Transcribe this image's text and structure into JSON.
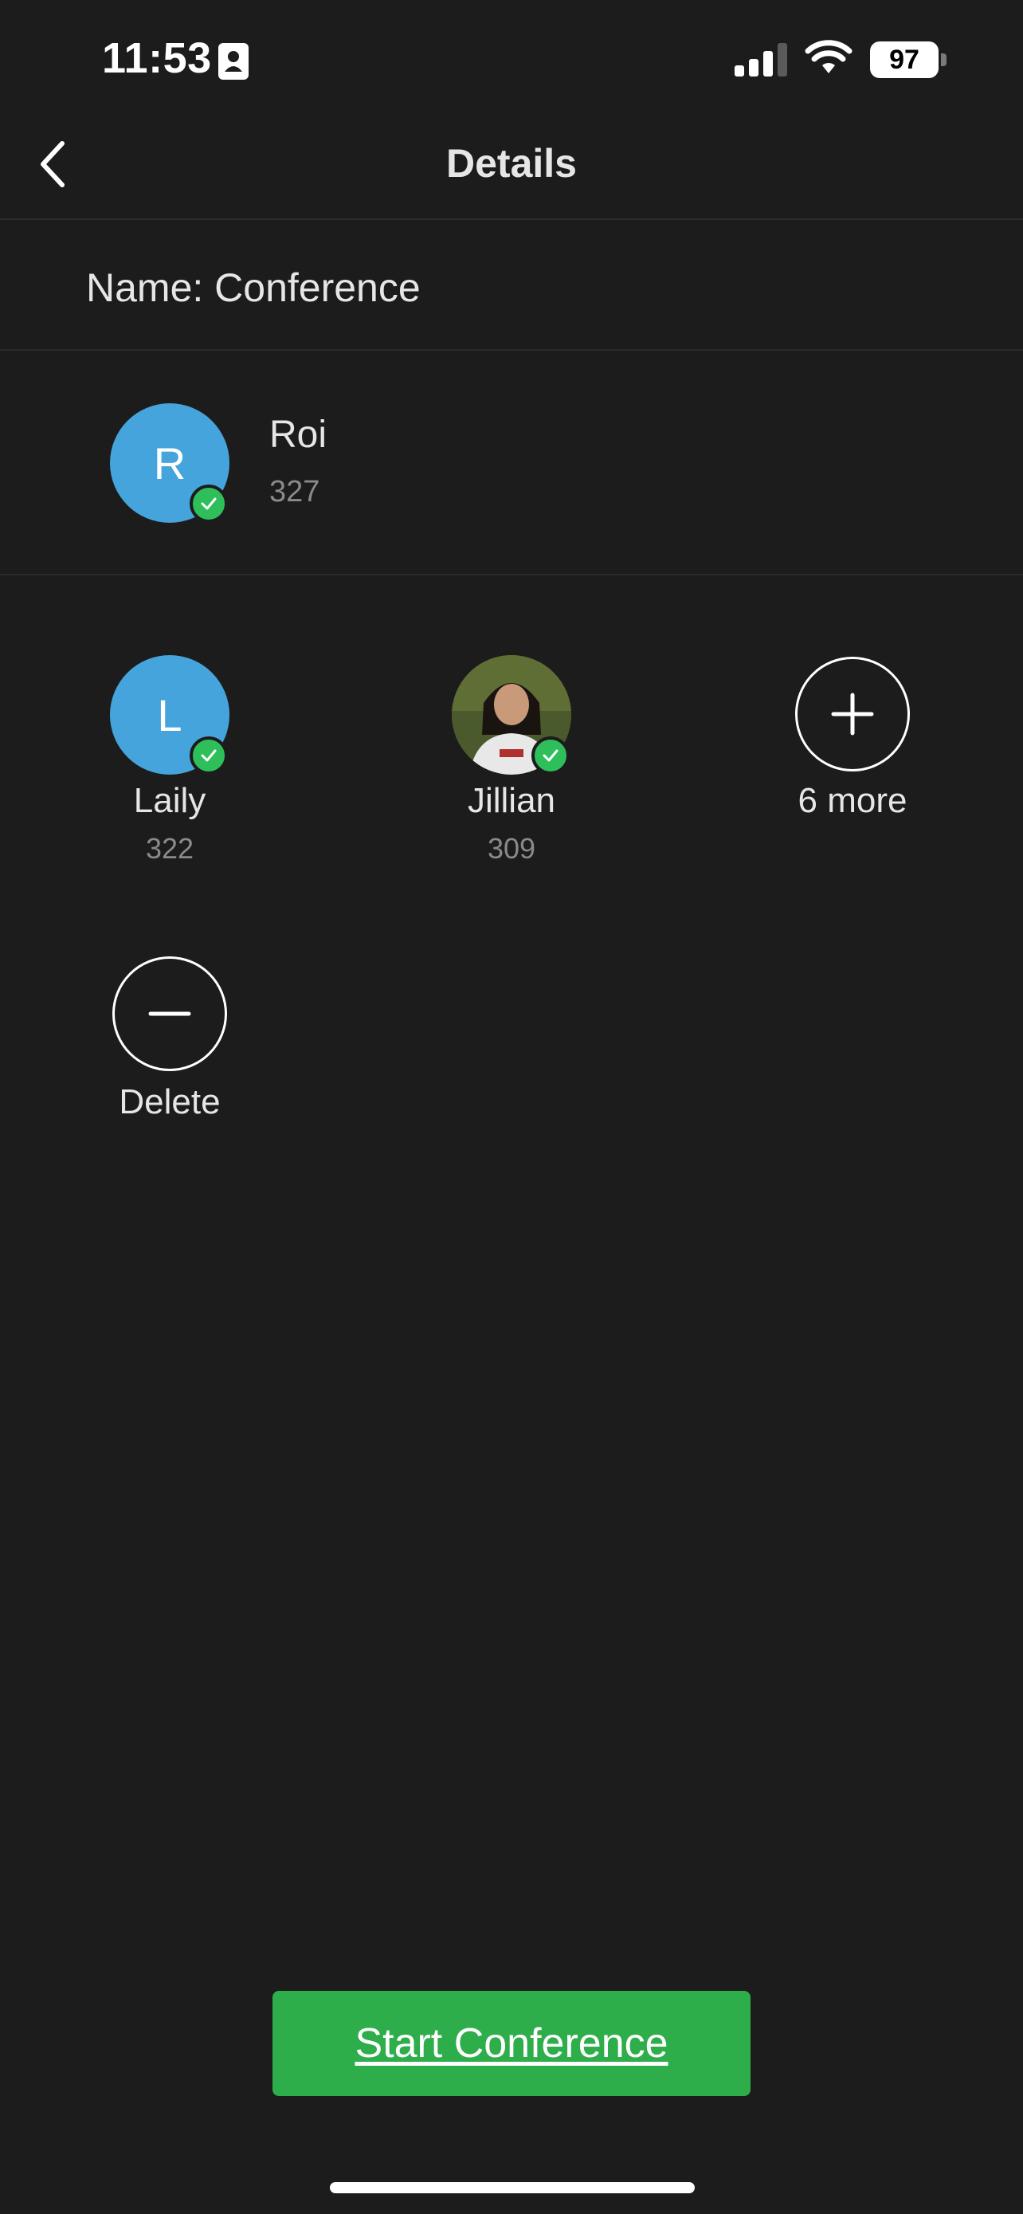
{
  "status_bar": {
    "time": "11:53",
    "battery": "97"
  },
  "nav": {
    "title": "Details"
  },
  "conference": {
    "name_label": "Name:",
    "name_value": "Conference"
  },
  "host": {
    "initial": "R",
    "name": "Roi",
    "extension": "327",
    "verified": true
  },
  "members": [
    {
      "initial": "L",
      "name": "Laily",
      "extension": "322",
      "verified": true
    },
    {
      "name": "Jillian",
      "extension": "309",
      "verified": true,
      "avatar": "photo"
    }
  ],
  "more_button": {
    "label": "6 more"
  },
  "delete_button": {
    "label": "Delete"
  },
  "start_button": {
    "label": "Start Conference"
  },
  "colors": {
    "background": "#1c1c1c",
    "avatar_blue": "#46a4dc",
    "verified_green": "#2fbf5a",
    "primary_button": "#2ead4b"
  }
}
